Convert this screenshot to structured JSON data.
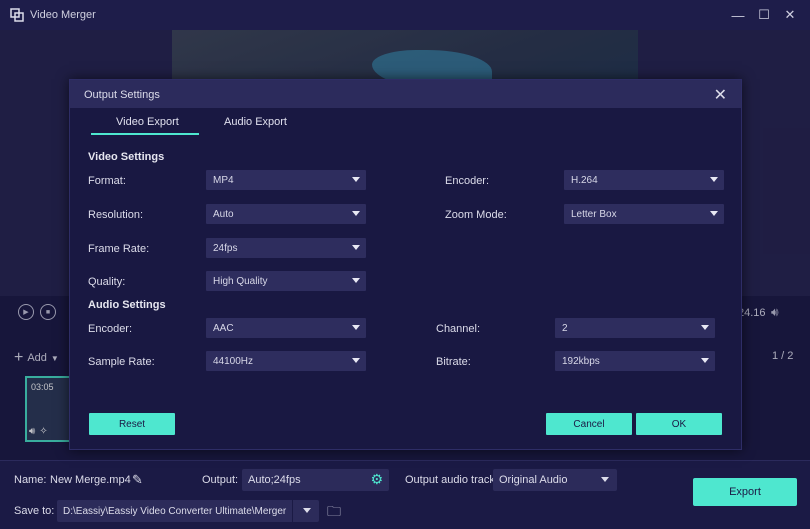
{
  "window": {
    "title": "Video Merger",
    "controls": {
      "minimize": "—",
      "maximize": "☐",
      "close": "✕"
    }
  },
  "player": {
    "time_display": "24.16"
  },
  "clips": {
    "add_label": "Add",
    "page": "1 / 2",
    "items": [
      {
        "duration": "03:05"
      }
    ]
  },
  "bottom": {
    "name_label": "Name:",
    "name_value": "New Merge.mp4",
    "output_label": "Output:",
    "output_value": "Auto;24fps",
    "audio_track_label": "Output audio track:",
    "audio_track_value": "Original Audio",
    "save_to_label": "Save to:",
    "save_to_value": "D:\\Eassiy\\Eassiy Video Converter Ultimate\\Merger",
    "export_label": "Export"
  },
  "dialog": {
    "title": "Output Settings",
    "tabs": [
      "Video Export",
      "Audio Export"
    ],
    "active_tab": "Video Export",
    "video_section": "Video Settings",
    "audio_section": "Audio Settings",
    "video": {
      "format_label": "Format:",
      "format_value": "MP4",
      "encoder_label": "Encoder:",
      "encoder_value": "H.264",
      "resolution_label": "Resolution:",
      "resolution_value": "Auto",
      "zoom_label": "Zoom Mode:",
      "zoom_value": "Letter Box",
      "framerate_label": "Frame Rate:",
      "framerate_value": "24fps",
      "quality_label": "Quality:",
      "quality_value": "High Quality"
    },
    "audio": {
      "encoder_label": "Encoder:",
      "encoder_value": "AAC",
      "channel_label": "Channel:",
      "channel_value": "2",
      "samplerate_label": "Sample Rate:",
      "samplerate_value": "44100Hz",
      "bitrate_label": "Bitrate:",
      "bitrate_value": "192kbps"
    },
    "buttons": {
      "reset": "Reset",
      "cancel": "Cancel",
      "ok": "OK"
    }
  },
  "colors": {
    "accent": "#4ee7cf",
    "background": "#1b1a45",
    "dialog": "#191842"
  }
}
